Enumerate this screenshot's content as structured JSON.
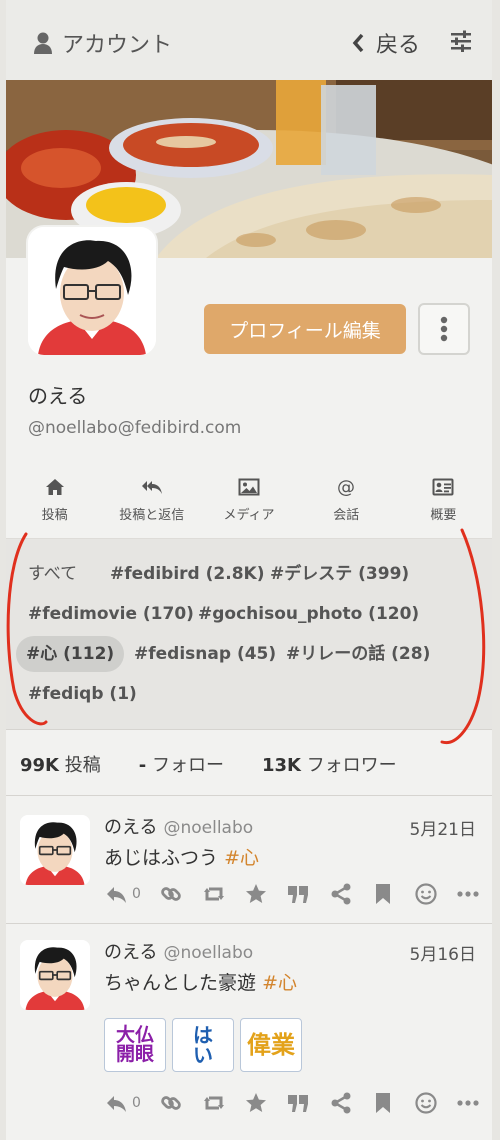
{
  "header": {
    "title": "アカウント",
    "back_label": "戻る"
  },
  "profile": {
    "display_name": "のえる",
    "handle": "@noellabo@fedibird.com",
    "edit_button_label": "プロフィール編集"
  },
  "tabs": [
    {
      "label": "投稿",
      "icon": "home-icon"
    },
    {
      "label": "投稿と返信",
      "icon": "reply-all-icon"
    },
    {
      "label": "メディア",
      "icon": "image-icon"
    },
    {
      "label": "会話",
      "icon": "at-icon"
    },
    {
      "label": "概要",
      "icon": "id-card-icon"
    }
  ],
  "hashtags": [
    {
      "label": "すべて"
    },
    {
      "label": "#fedibird (2.8K)"
    },
    {
      "label": "#デレステ (399)"
    },
    {
      "label": "#fedimovie (170)"
    },
    {
      "label": "#gochisou_photo (120)"
    },
    {
      "label": "#心 (112)",
      "selected": true
    },
    {
      "label": "#fedisnap (45)"
    },
    {
      "label": "#リレーの話 (28)"
    },
    {
      "label": "#fediqb (1)"
    }
  ],
  "stats": {
    "posts_value": "99K",
    "posts_label": "投稿",
    "following_value": "-",
    "following_label": "フォロー",
    "followers_value": "13K",
    "followers_label": "フォロワー"
  },
  "statuses": [
    {
      "name": "のえる",
      "handle": "@noellabo",
      "date": "5月21日",
      "text": "あじはふつう",
      "hashtag": "#心",
      "reply_count": "0",
      "emojis": []
    },
    {
      "name": "のえる",
      "handle": "@noellabo",
      "date": "5月16日",
      "text": "ちゃんとした豪遊",
      "hashtag": "#心",
      "reply_count": "0",
      "emojis": [
        {
          "line1": "大仏",
          "line2": "開眼",
          "color": "#8b1fa8"
        },
        {
          "line1": "は",
          "line2": "い",
          "color": "#1f5fb0"
        },
        {
          "line1": "偉業",
          "line2": "",
          "color": "#e3a21a"
        }
      ]
    }
  ],
  "colors": {
    "accent": "#dfa86a",
    "hashtag": "#d3852e",
    "annotation": "#e0301e"
  }
}
